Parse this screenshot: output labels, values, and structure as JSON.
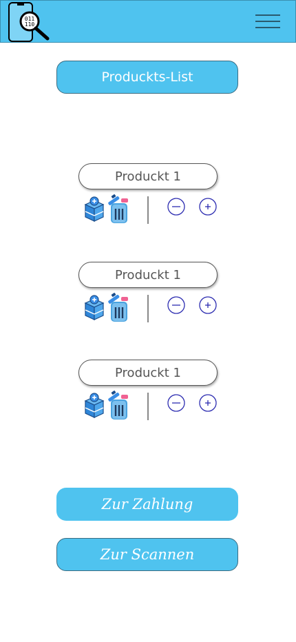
{
  "header": {
    "logo_icon": "phone-barcode-search-icon",
    "menu_icon": "hamburger-menu-icon",
    "background": "#4fc3ef"
  },
  "title_button": {
    "label": "Produckts-List"
  },
  "products": [
    {
      "name": "Produckt 1"
    },
    {
      "name": "Produckt 1"
    },
    {
      "name": "Produckt 1"
    }
  ],
  "actions": {
    "pay_label": "Zur Zahlung",
    "scan_label": "Zur Scannen"
  },
  "colors": {
    "accent": "#4fc3ef",
    "circle_buttons": "#2b2bb0",
    "trash_blue": "#4aa3df",
    "trash_pink": "#f06292"
  }
}
